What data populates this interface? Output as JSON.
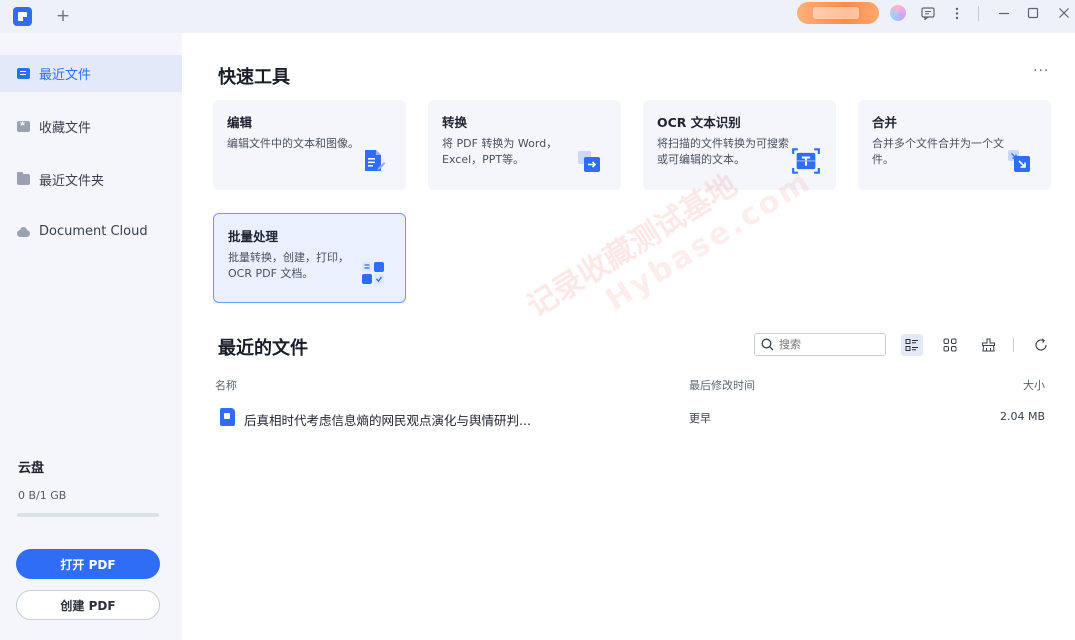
{
  "titlebar": {
    "new_tab_label": "+",
    "icons": [
      "app-logo-icon",
      "plus-icon",
      "avatar-icon",
      "message-icon",
      "more-vertical-icon",
      "minimize-icon",
      "maximize-icon",
      "close-icon"
    ]
  },
  "sidebar": {
    "items": [
      {
        "label": "最近文件",
        "icon": "recent-file-icon",
        "active": true
      },
      {
        "label": "收藏文件",
        "icon": "star-icon",
        "active": false
      },
      {
        "label": "最近文件夹",
        "icon": "folder-icon",
        "active": false
      },
      {
        "label": "Document Cloud",
        "icon": "cloud-icon",
        "active": false
      }
    ],
    "cloud": {
      "title": "云盘",
      "usage": "0 B/1 GB",
      "used_fraction": 0
    },
    "open_button": "打开 PDF",
    "create_button": "创建 PDF"
  },
  "quick_tools": {
    "title": "快速工具",
    "more": "···",
    "cards": [
      {
        "title": "编辑",
        "desc": "编辑文件中的文本和图像。",
        "icon": "edit-doc-icon"
      },
      {
        "title": "转换",
        "desc": "将 PDF 转换为 Word，Excel，PPT等。",
        "icon": "convert-icon"
      },
      {
        "title": "OCR 文本识别",
        "desc": "将扫描的文件转换为可搜索或可编辑的文本。",
        "icon": "ocr-icon"
      },
      {
        "title": "合并",
        "desc": "合并多个文件合并为一个文件。",
        "icon": "merge-icon"
      },
      {
        "title": "批量处理",
        "desc": "批量转换，创建，打印，OCR PDF 文档。",
        "icon": "batch-icon"
      }
    ]
  },
  "recent": {
    "title": "最近的文件",
    "search_placeholder": "搜索",
    "columns": {
      "name": "名称",
      "modified": "最后修改时间",
      "size": "大小"
    },
    "files": [
      {
        "name": "后真相时代考虑信息熵的网民观点演化与舆情研判...",
        "modified": "更早",
        "size": "2.04 MB"
      }
    ]
  },
  "watermark": {
    "line1": "记录收藏测试基地",
    "line2": "Hybase.com"
  },
  "colors": {
    "accent": "#2f6df6",
    "sidebar_bg": "#f4f6fb",
    "card_bg": "#f4f6fb",
    "active_nav_bg": "#e3e9f8"
  }
}
